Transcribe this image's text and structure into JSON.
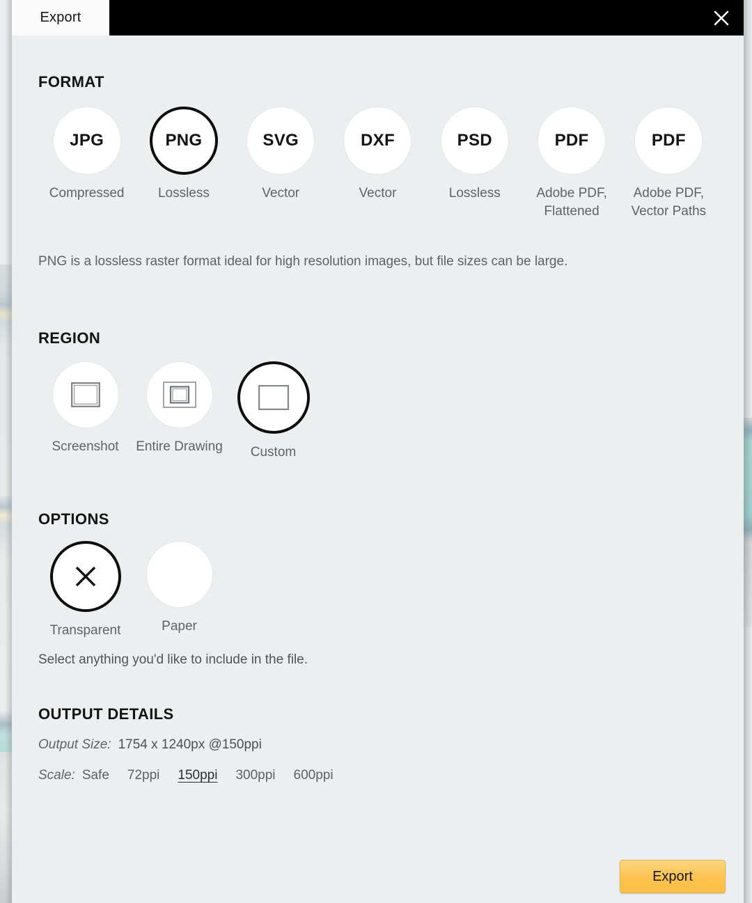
{
  "titlebar": {
    "tab_label": "Export",
    "close_icon": "close-icon"
  },
  "format": {
    "heading": "FORMAT",
    "options": [
      {
        "code": "JPG",
        "label": "Compressed",
        "selected": false
      },
      {
        "code": "PNG",
        "label": "Lossless",
        "selected": true
      },
      {
        "code": "SVG",
        "label": "Vector",
        "selected": false
      },
      {
        "code": "DXF",
        "label": "Vector",
        "selected": false
      },
      {
        "code": "PSD",
        "label": "Lossless",
        "selected": false
      },
      {
        "code": "PDF",
        "label": "Adobe PDF,\nFlattened",
        "selected": false
      },
      {
        "code": "PDF",
        "label": "Adobe PDF,\nVector Paths",
        "selected": false
      }
    ],
    "description": "PNG is a lossless raster format ideal for high resolution images, but file sizes can be large."
  },
  "region": {
    "heading": "REGION",
    "options": [
      {
        "icon": "screenshot-frame-icon",
        "label": "Screenshot",
        "selected": false
      },
      {
        "icon": "entire-drawing-frame-icon",
        "label": "Entire\nDrawing",
        "selected": false
      },
      {
        "icon": "custom-frame-icon",
        "label": "Custom",
        "selected": true
      }
    ]
  },
  "options": {
    "heading": "OPTIONS",
    "items": [
      {
        "icon": "transparent-x-icon",
        "label": "Transparent",
        "selected": true
      },
      {
        "icon": "paper-blank-icon",
        "label": "Paper",
        "selected": false
      }
    ],
    "description": "Select anything you'd like to include in the file."
  },
  "output_details": {
    "heading": "OUTPUT DETAILS",
    "output_size_key": "Output Size:",
    "output_size_value": "1754 x 1240px @150ppi",
    "scale_key": "Scale:",
    "scale_options": [
      {
        "label": "Safe",
        "selected": false
      },
      {
        "label": "72ppi",
        "selected": false
      },
      {
        "label": "150ppi",
        "selected": true
      },
      {
        "label": "300ppi",
        "selected": false
      },
      {
        "label": "600ppi",
        "selected": false
      }
    ]
  },
  "footer": {
    "export_button_label": "Export"
  },
  "colors": {
    "dialog_background": "#eceff0",
    "titlebar": "#000000",
    "tab_background": "#fbfbfb",
    "accent_button": "#fcc34f",
    "selected_ring": "#0d0d0d",
    "muted_text": "#5e6366"
  }
}
